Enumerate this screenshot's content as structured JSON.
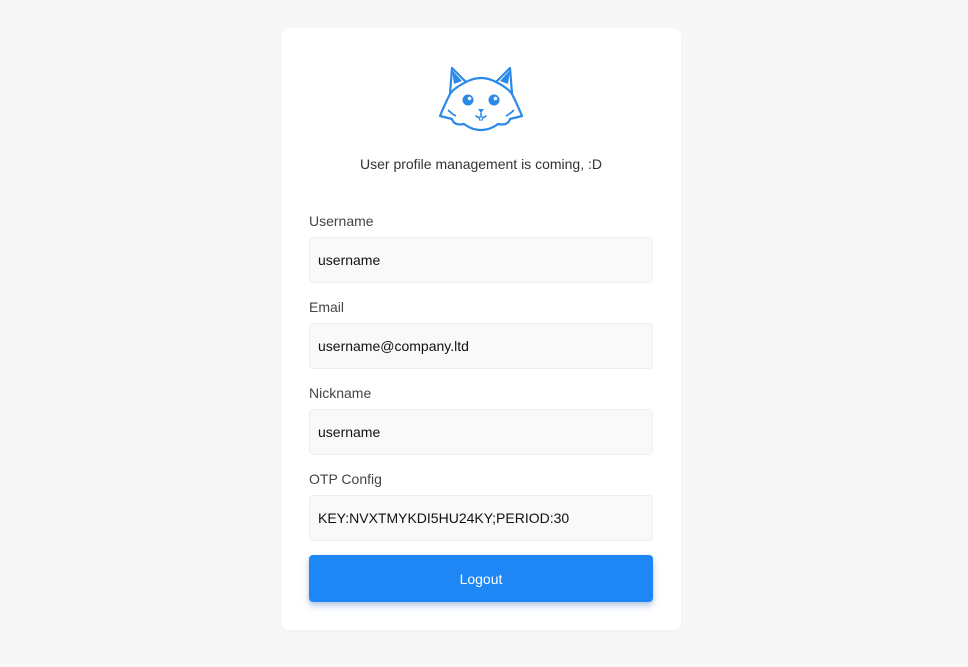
{
  "subtitle": "User profile management is coming, :D",
  "form": {
    "username": {
      "label": "Username",
      "value": "username"
    },
    "email": {
      "label": "Email",
      "value": "username@company.ltd"
    },
    "nickname": {
      "label": "Nickname",
      "value": "username"
    },
    "otp": {
      "label": "OTP Config",
      "value": "KEY:NVXTMYKDI5HU24KY;PERIOD:30"
    }
  },
  "logout_label": "Logout",
  "logo_icon": "cat-face-icon",
  "colors": {
    "accent": "#1f86f5",
    "background": "#f7f7f8",
    "input_bg": "#f9f9f9"
  }
}
